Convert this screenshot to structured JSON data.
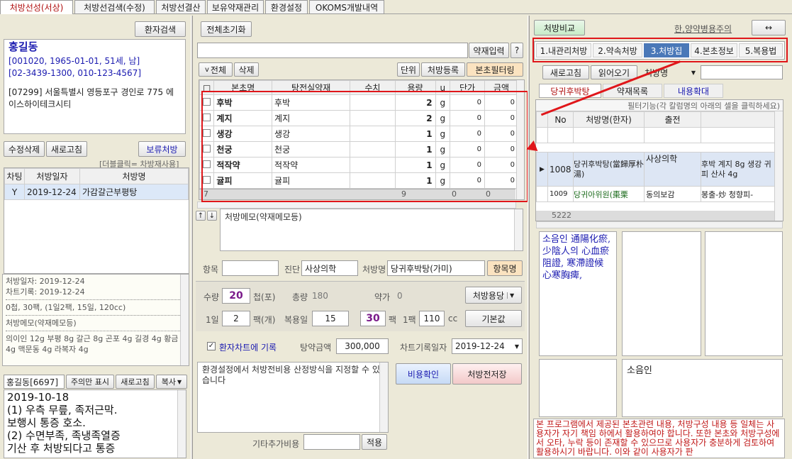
{
  "top_tabs": [
    "처방선성(서상)",
    "처방선검색(수정)",
    "처방선결산",
    "보유약재관리",
    "환경설정",
    "OKOMS개발내역"
  ],
  "left": {
    "patient_search_label": "환자검색",
    "patient_name": "홍길동",
    "patient_line1": "[001020, 1965-01-01, 51세, 남]",
    "patient_line2": "[02-3439-1300, 010-123-4567]",
    "patient_address": "[07299] 서울특별시 영등포구 경인로 775 에이스하이테크시티",
    "edit_delete_label": "수정삭제",
    "refresh_label": "새로고침",
    "hold_rx_label": "보류처방",
    "dblclick_hint": "[더블클릭= 차방재사용]",
    "history_headers": [
      "차팅",
      "처방일자",
      "처방명"
    ],
    "history_rows": [
      {
        "chart": "Y",
        "date": "2019-12-24",
        "name": "가감갈근부평탕"
      }
    ],
    "detail_lines": [
      "처방일자: 2019-12-24",
      "차트기록: 2019-12-24",
      "0첩, 30팩, (1일2팩, 15일, 120cc)",
      "처방메모(약재메모등)",
      "의이인 12g 부평 8g 갈근 8g 곤포 4g 길경 4g 황금 4g 맥문동 4g 라복자 4g"
    ],
    "memo_tab_label": "홍길동[6697]",
    "memo_only_label": "주의만 표시",
    "memo_refresh_label": "새로고침",
    "memo_copy_label": "복사",
    "memo_lines": [
      "2019-10-18",
      "(1) 우측 무릎, 족저근막.",
      "보행시 통증 호소.",
      "(2) 수면부족, 족냉족열증",
      "기산 후 처방되다고 통증"
    ]
  },
  "middle": {
    "reset_label": "전체초기화",
    "herb_input_label": "약재입력",
    "help_label": "?",
    "select_all_label": "전체",
    "delete_label": "삭제",
    "unit_label": "단위",
    "register_label": "처방등록",
    "filter_label": "본초필터링",
    "grid_headers": [
      "□",
      "본초명",
      "탕전실약재",
      "수치",
      "용량",
      "u",
      "단가",
      "금액"
    ],
    "grid_rows": [
      {
        "name": "후박",
        "herb": "후박",
        "qty": "",
        "dose": "2",
        "unit": "g",
        "price": "0",
        "amount": "0"
      },
      {
        "name": "계지",
        "herb": "계지",
        "qty": "",
        "dose": "2",
        "unit": "g",
        "price": "0",
        "amount": "0"
      },
      {
        "name": "생강",
        "herb": "생강",
        "qty": "",
        "dose": "1",
        "unit": "g",
        "price": "0",
        "amount": "0"
      },
      {
        "name": "천궁",
        "herb": "천궁",
        "qty": "",
        "dose": "1",
        "unit": "g",
        "price": "0",
        "amount": "0"
      },
      {
        "name": "적작약",
        "herb": "적작약",
        "qty": "",
        "dose": "1",
        "unit": "g",
        "price": "0",
        "amount": "0"
      },
      {
        "name": "귤피",
        "herb": "귤피",
        "qty": "",
        "dose": "1",
        "unit": "g",
        "price": "0",
        "amount": "0"
      }
    ],
    "footer_count": "7",
    "footer_dose": "9",
    "footer_price": "0",
    "footer_amount": "0",
    "memo_placeholder": "처방메모(약재메모등)",
    "item_label": "항목",
    "diagnosis_label": "진단",
    "diagnosis_value": "사상의학",
    "rx_name_label": "처방명",
    "rx_name_value": "당귀후박탕(가미)",
    "item_list_label": "항목명",
    "amount_label": "수량",
    "amount_value": "20",
    "amount_unit": "첩(포)",
    "total_label": "총량",
    "total_value": "180",
    "herb_price_label": "약가",
    "herb_price_value": "0",
    "usage_label": "처방용당",
    "daily_label": "1일",
    "daily_value": "2",
    "daily_unit": "팩(개)",
    "days_label": "복용일",
    "days_value": "15",
    "packs_value": "30",
    "packs_unit": "팩",
    "per_pack_label": "1팩",
    "per_pack_value": "110",
    "per_pack_unit": "cc",
    "default_label": "기본값",
    "chart_record_label": "환자차트에 기록",
    "decoction_price_label": "탕약금액",
    "decoction_price_value": "300,000",
    "chart_date_label": "차트기록일자",
    "chart_date_value": "2019-12-24",
    "cost_note": "환경설정에서 처방전비용 산정방식을 지정할 수 있습니다",
    "cost_check_label": "비용확인",
    "save_rx_label": "처방전저장",
    "extra_cost_label": "기타추가비용",
    "apply_label": "적용"
  },
  "right": {
    "compare_label": "처방비교",
    "drug_caution_label": "한,양약병용주의",
    "expand_label": "↔",
    "tabs": [
      "1.내관리처방",
      "2.약속처방",
      "3.처방집",
      "4.본초정보",
      "5.복용법"
    ],
    "refresh_label": "새로고침",
    "load_label": "읽어오기",
    "rx_name_select": "처방명",
    "subtabs": [
      "당귀후박탕",
      "약재목록",
      "내용확대"
    ],
    "filter_hint": "필터기능(각 칼럼명의 아래의 셀을 클릭하세요)",
    "grid_headers": [
      "No",
      "처방명(한자)",
      "출전",
      ""
    ],
    "grid_rows": [
      {
        "no": "1008",
        "name": "당귀후박탕(當歸厚朴湯)",
        "source": "사상의학",
        "herbs": "후박 계지 8g 생강 귀 진피 산사 4g"
      },
      {
        "no": "1009",
        "name": "당귀아위원(棗栗",
        "source": "동의보감",
        "herbs": "봉출-炒 청향피-"
      }
    ],
    "grid_count": "5222",
    "text_hanja": "소음인 通陽化瘀, 少陰人의 心血瘀阻證, 寒滯證候 心寒胸痺,",
    "text_bottom": "소음인",
    "disclaimer": "본 프로그램에서 제공된 본초관련 내용, 처방구성 내용 등 일체는 사용자가 자기 책임 하에서 활용하여야 합니다. 또한 본초와 처방구성에서 오타, 누락 등이 존재할 수 있으므로 사용자가 충분하게 검토하여 활용하시기 바랍니다. 이와 같이 사용자가 판"
  }
}
